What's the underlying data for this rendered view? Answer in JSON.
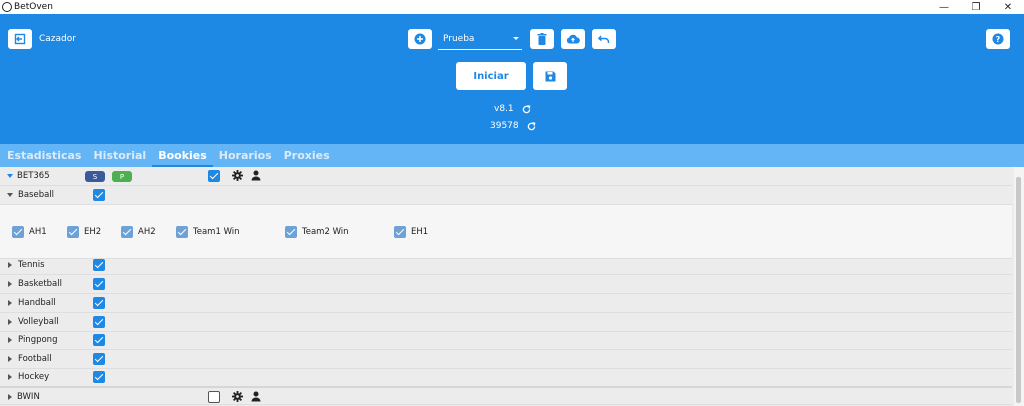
{
  "window": {
    "title": "BetOven",
    "minimize": "—",
    "restore": "❐",
    "close": "✕"
  },
  "header": {
    "mode_label": "Cazador",
    "profile": "Prueba",
    "start_label": "Iniciar",
    "version": "v8.1",
    "count": "39578",
    "icons": [
      "exit-icon",
      "plus-icon",
      "trash-icon",
      "cloud-upload-icon",
      "undo-icon",
      "help-icon",
      "save-icon",
      "refresh-icon"
    ]
  },
  "tabs": [
    {
      "label": "Estadisticas",
      "active": false
    },
    {
      "label": "Historial",
      "active": false
    },
    {
      "label": "Bookies",
      "active": true
    },
    {
      "label": "Horarios",
      "active": false
    },
    {
      "label": "Proxies",
      "active": false
    }
  ],
  "bookies": [
    {
      "name": "BET365",
      "badges": [
        "S",
        "P"
      ],
      "enabled": true,
      "sports": [
        {
          "name": "Baseball",
          "enabled": true,
          "expanded": true,
          "markets": [
            {
              "label": "AH1",
              "checked": true
            },
            {
              "label": "EH2",
              "checked": true
            },
            {
              "label": "AH2",
              "checked": true
            },
            {
              "label": "Team1 Win",
              "checked": true
            },
            {
              "label": "Team2 Win",
              "checked": true
            },
            {
              "label": "EH1",
              "checked": true
            }
          ]
        },
        {
          "name": "Tennis",
          "enabled": true
        },
        {
          "name": "Basketball",
          "enabled": true
        },
        {
          "name": "Handball",
          "enabled": true
        },
        {
          "name": "Volleyball",
          "enabled": true
        },
        {
          "name": "Pingpong",
          "enabled": true
        },
        {
          "name": "Football",
          "enabled": true
        },
        {
          "name": "Hockey",
          "enabled": true
        }
      ]
    },
    {
      "name": "BWIN",
      "enabled": false
    }
  ],
  "colors": {
    "primary": "#1e88e5",
    "tab_bar": "#64b5f6",
    "badge_s": "#3a5a9c",
    "badge_p": "#4caf50"
  }
}
